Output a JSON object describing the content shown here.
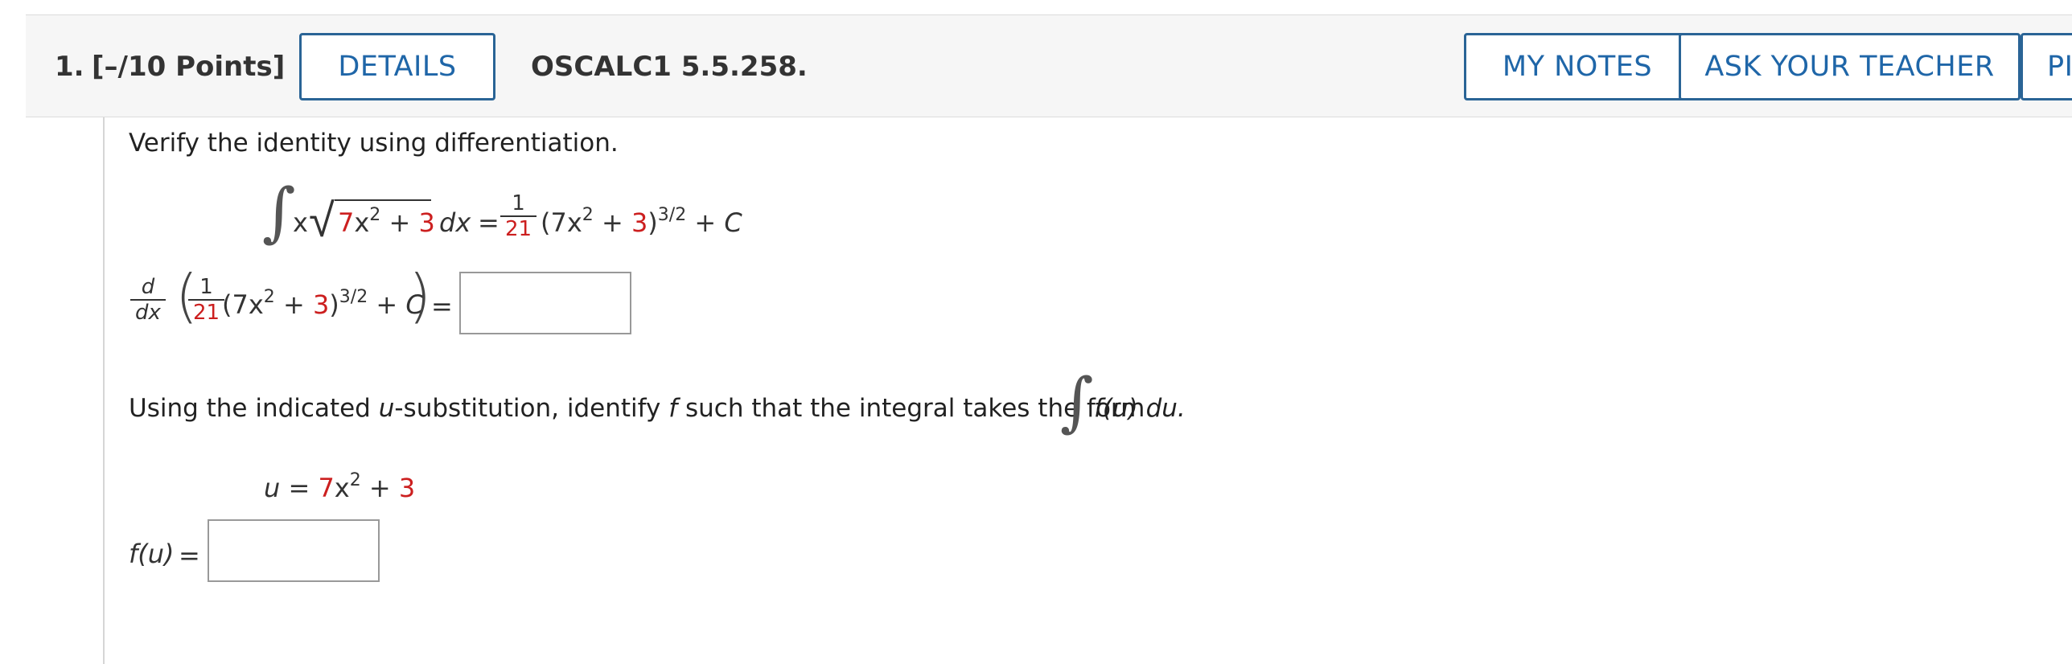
{
  "header": {
    "question_number": "1.",
    "points": "[–/10 Points]",
    "details_label": "DETAILS",
    "assignment_id": "OSCALC1 5.5.258.",
    "my_notes_label": "MY NOTES",
    "ask_teacher_label": "ASK YOUR TEACHER",
    "practice_label_partial": "PI"
  },
  "problem": {
    "instruction": "Verify the identity using differentiation.",
    "identity": {
      "integrand_x": "x",
      "radicand_coef": "7",
      "radicand_var": "x",
      "radicand_exp": "2",
      "radicand_plus": "+",
      "radicand_const": "3",
      "dx": "dx",
      "equals": "=",
      "frac_num": "1",
      "frac_den": "21",
      "rhs_open": "(7x",
      "rhs_exp": "2",
      "rhs_plus": " + ",
      "rhs_const": "3",
      "rhs_close": ")",
      "rhs_power": "3/2",
      "rhs_c": " + C"
    },
    "derivative": {
      "d": "d",
      "dx": "dx",
      "frac_num": "1",
      "frac_den": "21",
      "open": "(7x",
      "exp": "2",
      "plus": " + ",
      "const": "3",
      "close": ")",
      "power": "3/2",
      "c": " + C",
      "equals": "="
    },
    "substitution_text_1": "Using the indicated ",
    "substitution_u": "u",
    "substitution_text_2": "-substitution, identify ",
    "substitution_f": "f",
    "substitution_text_3": " such that the integral takes the form",
    "form_fu": "f(u) du.",
    "u_def": {
      "u": "u",
      "equals": " = ",
      "coef": "7",
      "var": "x",
      "exp": "2",
      "plus": " + ",
      "const": "3"
    },
    "fu_label": "f(u)",
    "fu_equals": "="
  }
}
